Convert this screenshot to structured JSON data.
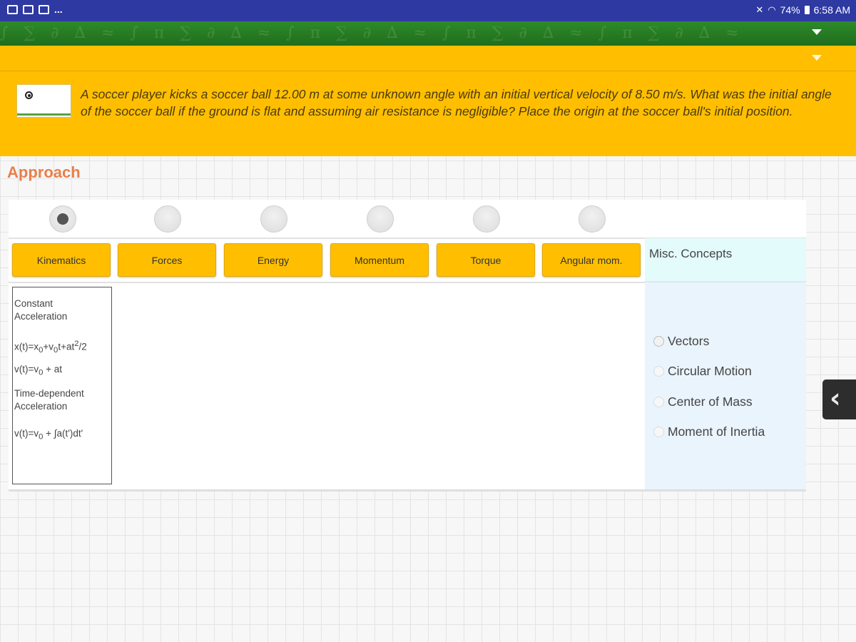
{
  "status_bar": {
    "left_icons": [
      "image-icon",
      "gallery-icon",
      "email-icon"
    ],
    "overflow": "...",
    "battery": "74%",
    "time": "6:58 AM"
  },
  "question": {
    "text": "A soccer player kicks a soccer ball 12.00 m at some unknown angle with an initial vertical velocity of 8.50 m/s. What was the initial angle of the soccer ball if the ground is flat and assuming air resistance is negligible? Place the origin at the soccer ball's initial position."
  },
  "approach": {
    "title": "Approach",
    "selected_index": 0,
    "tabs": [
      "Kinematics",
      "Forces",
      "Energy",
      "Momentum",
      "Torque",
      "Angular mom."
    ]
  },
  "equations": {
    "const_accel_heading_1": "Constant",
    "const_accel_heading_2": "Acceleration",
    "pos_prefix": "x(t)=x",
    "pos_sub0": "0",
    "pos_mid": "+v",
    "pos_sub1": "0",
    "pos_tail": "t+at",
    "pos_sup": "2",
    "pos_end": "/2",
    "vel_prefix": "v(t)=v",
    "vel_sub": "0",
    "vel_tail": " + at",
    "time_dep_heading_1": "Time-dependent",
    "time_dep_heading_2": "Acceleration",
    "int_prefix": "v(t)=v",
    "int_sub": "0",
    "int_tail": " + ∫a(t')dt'"
  },
  "misc": {
    "title": "Misc. Concepts",
    "items": [
      "Vectors",
      "Circular Motion",
      "Center of Mass",
      "Moment of Inertia"
    ]
  },
  "side_tab": {
    "icon": "chevron-left-icon"
  }
}
